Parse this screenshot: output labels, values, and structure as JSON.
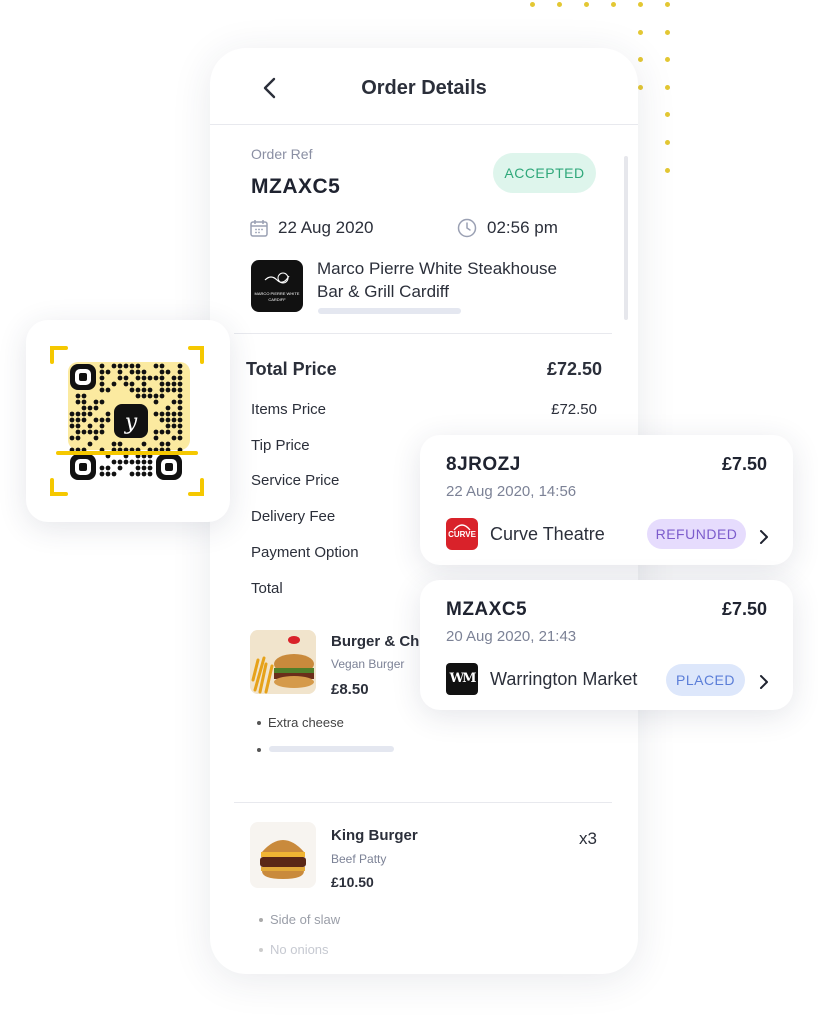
{
  "header": {
    "title": "Order Details"
  },
  "order": {
    "ref_label": "Order Ref",
    "ref": "MZAXC5",
    "status": "ACCEPTED",
    "date": "22 Aug 2020",
    "time": "02:56 pm",
    "venue_line1": "Marco Pierre White Steakhouse",
    "venue_line2": "Bar & Grill Cardiff",
    "venue_logo_text1": "MARCO PIERRE WHITE",
    "venue_logo_text2": "CARDIFF"
  },
  "pricing": {
    "total_label": "Total Price",
    "total_value": "£72.50",
    "rows": [
      {
        "label": "Items Price",
        "value": "£72.50"
      },
      {
        "label": "Tip Price",
        "value": ""
      },
      {
        "label": "Service Price",
        "value": ""
      },
      {
        "label": "Delivery Fee",
        "value": ""
      },
      {
        "label": "Payment Option",
        "value": ""
      },
      {
        "label": "Total",
        "value": ""
      }
    ]
  },
  "items": [
    {
      "name": "Burger & Ch",
      "sub": "Vegan Burger",
      "price": "£8.50",
      "qty": "",
      "extras": [
        "Extra cheese"
      ]
    },
    {
      "name": "King Burger",
      "sub": "Beef Patty",
      "price": "£10.50",
      "qty": "x3",
      "extras": [
        "Side of slaw",
        "No onions"
      ]
    }
  ],
  "orders_list": [
    {
      "ref": "8JROZJ",
      "amount": "£7.50",
      "datetime": "22 Aug 2020, 14:56",
      "venue": "Curve Theatre",
      "logo_text": "CURVE",
      "status": "REFUNDED"
    },
    {
      "ref": "MZAXC5",
      "amount": "£7.50",
      "datetime": "20 Aug 2020, 21:43",
      "venue": "Warrington Market",
      "logo_text": "WM",
      "status": "PLACED"
    }
  ],
  "colors": {
    "accent_yellow": "#f5c800",
    "accepted_bg": "#def5ec",
    "accepted_text": "#2fa87a",
    "refunded_bg": "#e6dcfd",
    "placed_bg": "#dde7fb",
    "curve_red": "#d9222a"
  }
}
